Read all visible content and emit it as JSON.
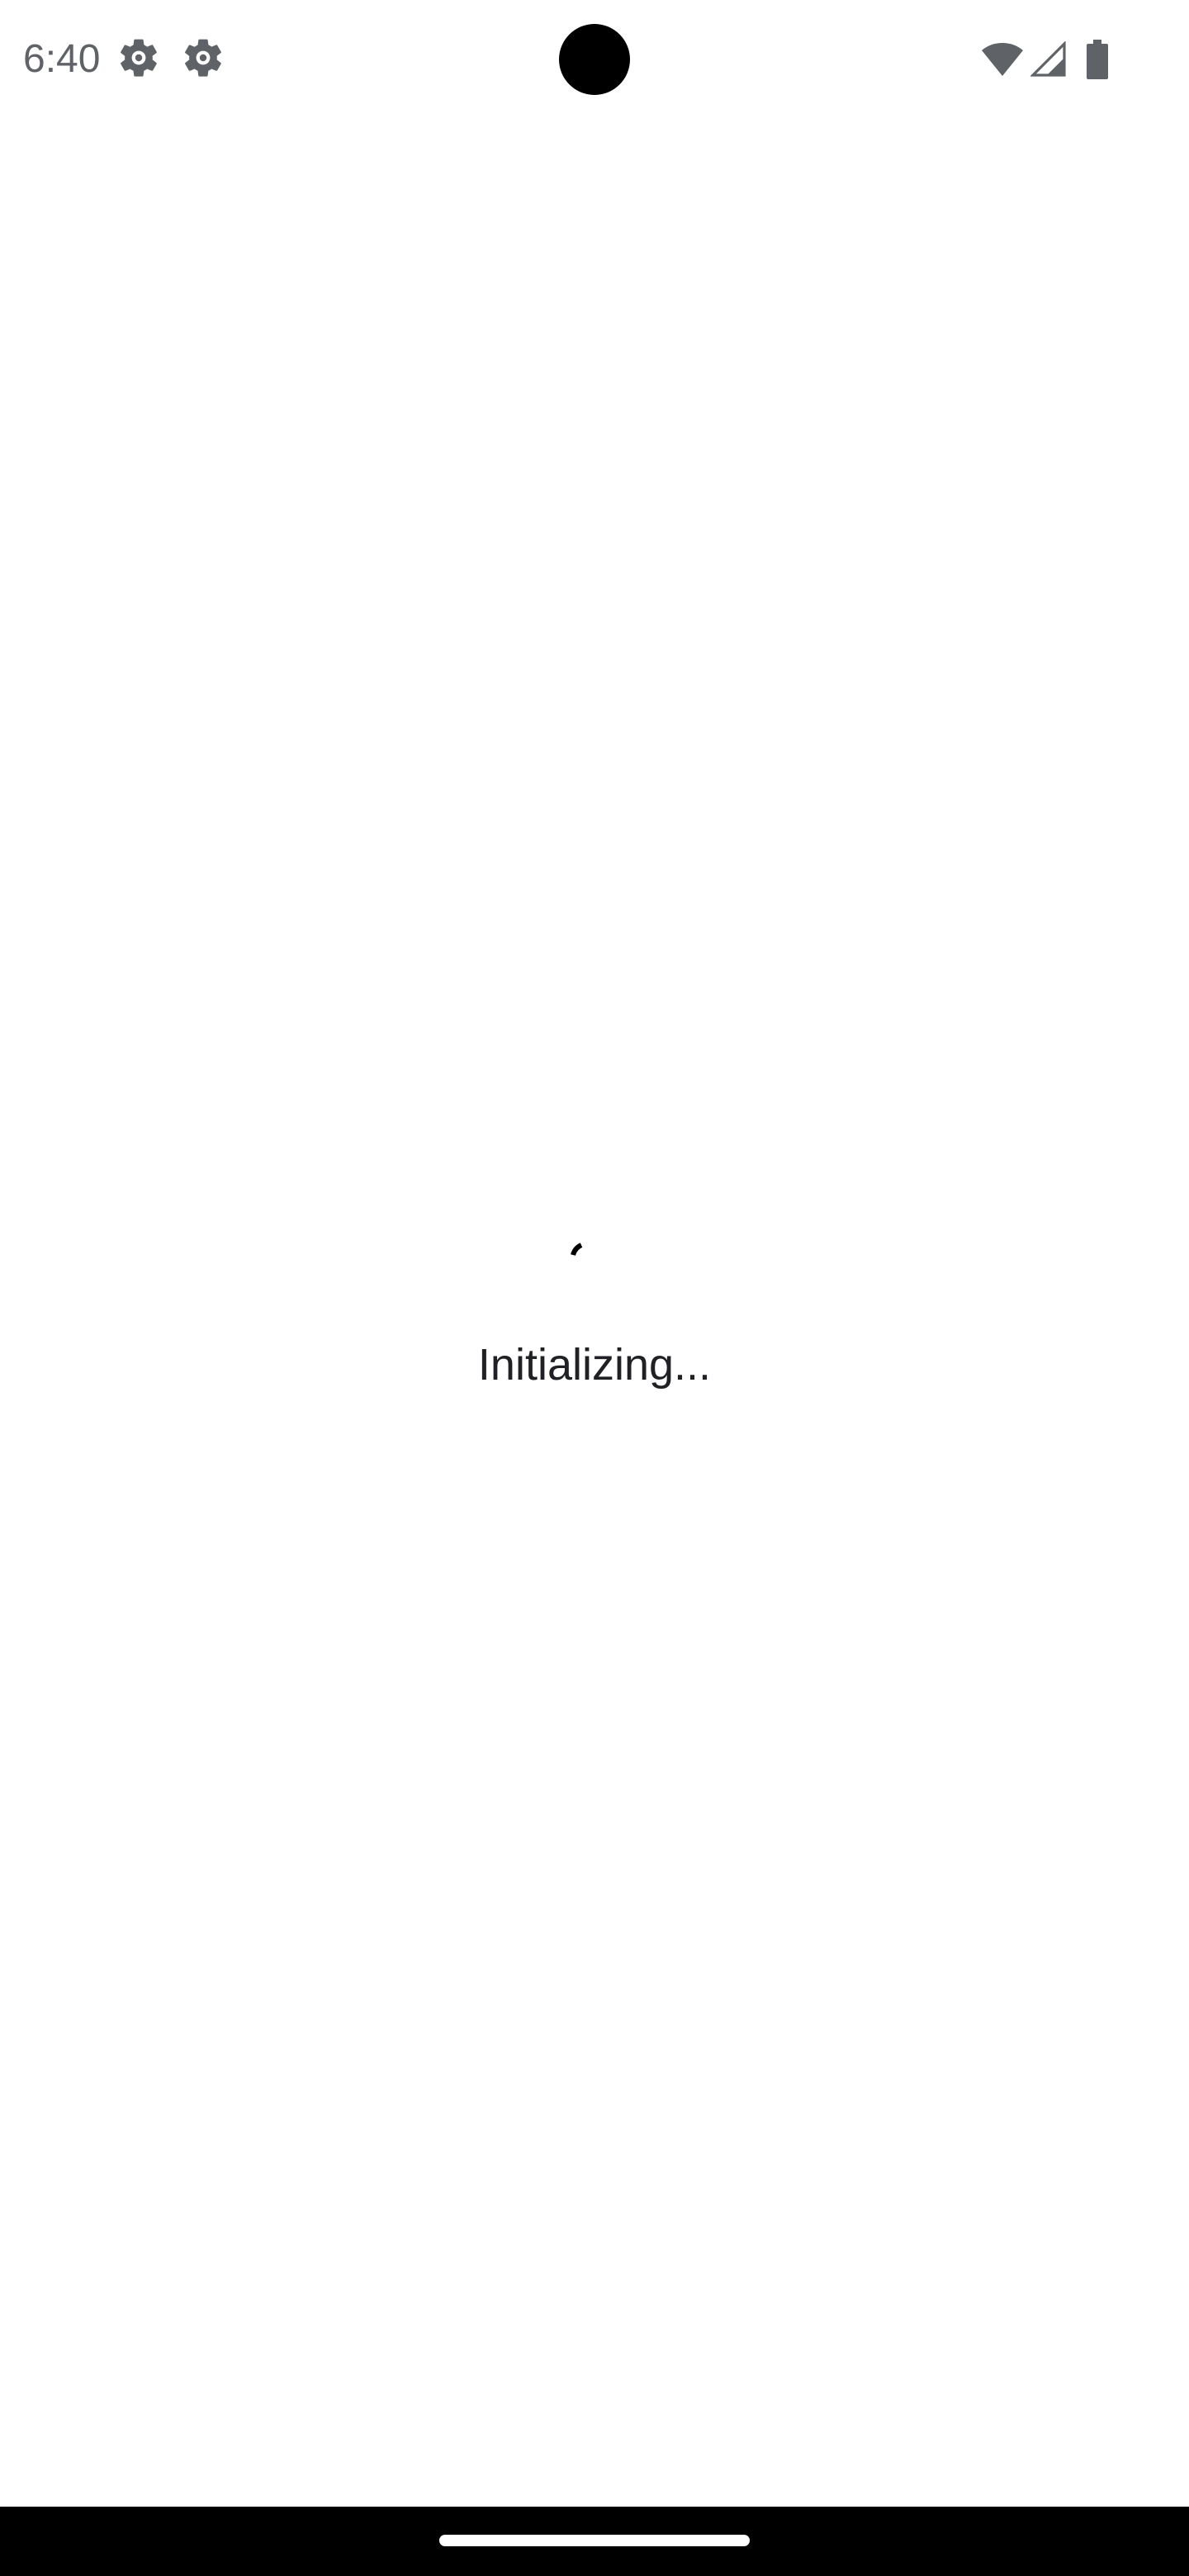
{
  "status_bar": {
    "time": "6:40",
    "icons": [
      "gear-icon",
      "gear-icon",
      "wifi-icon",
      "cellular-signal-icon",
      "battery-icon"
    ],
    "icon_color": "#5f6368"
  },
  "main": {
    "loading_text": "Initializing...",
    "spinner_color": "#000000",
    "text_color": "#202124"
  },
  "nav_bar": {
    "background": "#000000",
    "handle_color": "#ffffff"
  }
}
